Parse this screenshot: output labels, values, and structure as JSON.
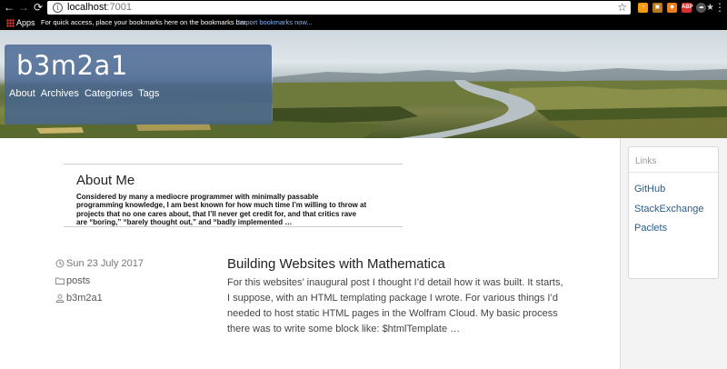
{
  "browser": {
    "url_host": "localhost",
    "url_port": ":7001",
    "bookmarks": {
      "apps_label": "Apps",
      "hint": "For quick access, place your bookmarks here on the bookmarks bar.",
      "import_link": "Import bookmarks now..."
    },
    "extensions": [
      {
        "name": "rss-icon",
        "color": "#f39c12"
      },
      {
        "name": "extension-icon",
        "color": "#c0392b"
      },
      {
        "name": "extension-icon",
        "color": "#e67e22"
      },
      {
        "name": "adblock-icon",
        "color": "#d63031"
      },
      {
        "name": "cloud-icon",
        "color": "#7f8c8d"
      },
      {
        "name": "bookmark-star-icon",
        "color": "#95a5a6"
      }
    ]
  },
  "site": {
    "title": "b3m2a1",
    "nav": [
      "About",
      "Archives",
      "Categories",
      "Tags"
    ]
  },
  "about": {
    "title": "About Me",
    "text": "Considered by many a mediocre programmer with minimally passable programming knowledge, I am best known for how much time I’m willing to throw at projects that no one cares about, that I’ll never get credit for, and that critics rave are “boring,” “barely thought out,” and “badly implemented …"
  },
  "post": {
    "date": "Sun 23 July 2017",
    "category": "posts",
    "author": "b3m2a1",
    "title": "Building Websites with Mathematica",
    "excerpt": "For this websites’ inaugural post I thought I’d detail how it was built. It starts, I suppose, with an HTML templating package I wrote. For various things I’d needed to host static HTML pages in the Wolfram Cloud. My basic process there was to write some block like: $htmlTemplate …"
  },
  "sidebar": {
    "heading": "Links",
    "links": [
      "GitHub",
      "StackExchange",
      "Paclets"
    ]
  }
}
